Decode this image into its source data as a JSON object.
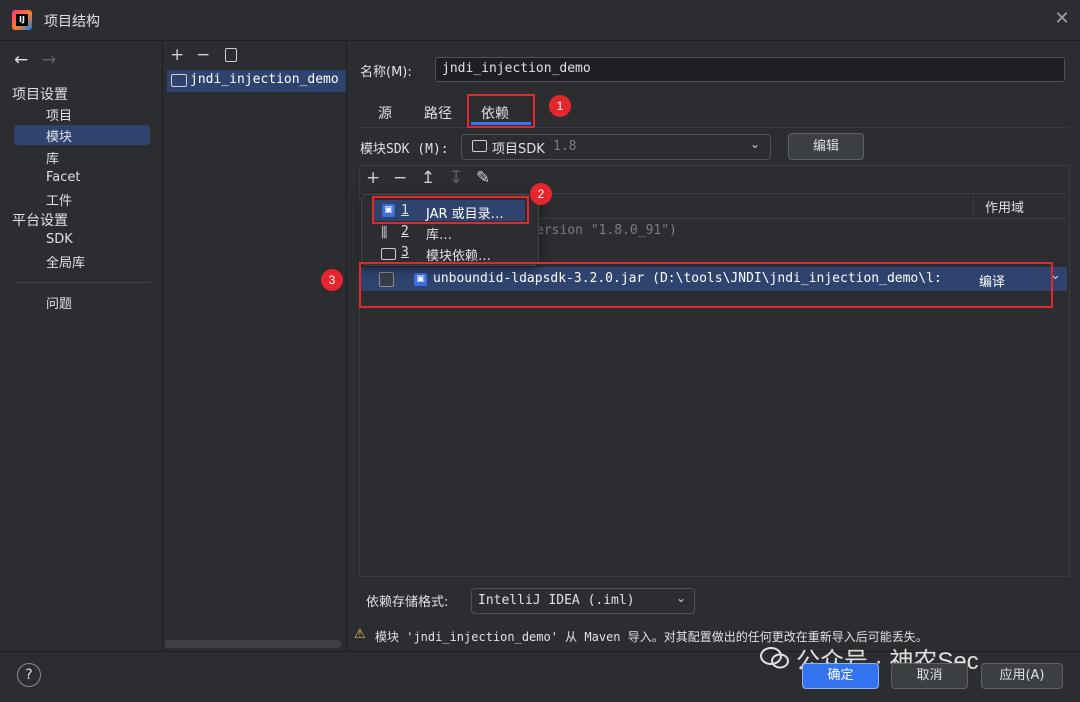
{
  "window": {
    "title": "项目结构"
  },
  "nav": {
    "back": "←",
    "forward": "→",
    "project_settings": "项目设置",
    "project_items": [
      "项目",
      "模块",
      "库",
      "Facet",
      "工件"
    ],
    "platform_settings": "平台设置",
    "platform_items": [
      "SDK",
      "全局库"
    ],
    "problems": "问题",
    "selected": "模块"
  },
  "module_list": {
    "items": [
      "jndi_injection_demo"
    ]
  },
  "name": {
    "label": "名称(M):",
    "value": "jndi_injection_demo"
  },
  "tabs": [
    "源",
    "路径",
    "依赖"
  ],
  "active_tab": "依赖",
  "sdk": {
    "label": "模块SDK (M):",
    "value": "项目SDK",
    "version": "1.8",
    "edit": "编辑"
  },
  "table": {
    "header_scope": "作用域",
    "rows": [
      {
        "text": "ersion \"1.8.0_91\")",
        "scope": ""
      },
      {
        "text": "unboundid-ldapsdk-3.2.0.jar (D:\\tools\\JNDI\\jndi_injection_demo\\l:",
        "scope": "编译"
      }
    ]
  },
  "add_menu": {
    "items": [
      {
        "num": "1",
        "label": "JAR 或目录…",
        "icon": "jar-icon"
      },
      {
        "num": "2",
        "label": "库…",
        "icon": "library-icon"
      },
      {
        "num": "3",
        "label": "模块依赖…",
        "icon": "module-icon"
      }
    ]
  },
  "storage": {
    "label": "依赖存储格式:",
    "value": "IntelliJ IDEA (.iml)"
  },
  "warning": "模块 'jndi_injection_demo' 从 Maven 导入。对其配置做出的任何更改在重新导入后可能丢失。",
  "annotations": [
    "1",
    "2",
    "3"
  ],
  "buttons": {
    "help": "?",
    "ok": "确定",
    "cancel": "取消",
    "apply": "应用(A)"
  },
  "watermark": "公众号 · 神农Sec",
  "colors": {
    "accent": "#3574f0",
    "selection": "#2e436e",
    "annotation": "#e5272d",
    "background": "#2b2d30"
  }
}
